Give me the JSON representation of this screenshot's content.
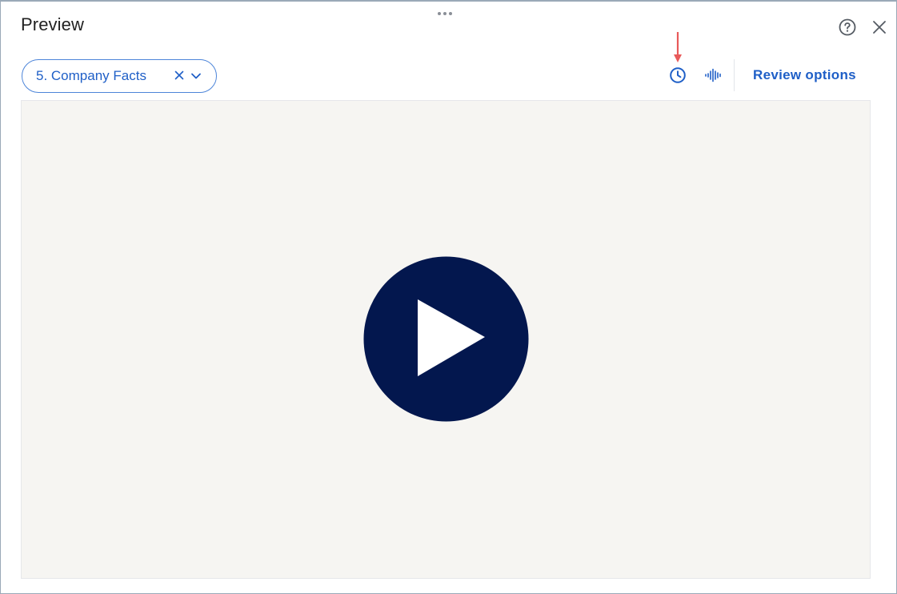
{
  "panel": {
    "title": "Preview"
  },
  "header_icons": {
    "help": "question-circle-icon",
    "close": "close-icon",
    "drag": "drag-handle-icon"
  },
  "toolbar": {
    "selector_label": "5. Company Facts",
    "clear_icon": "x-icon",
    "dropdown_icon": "chevron-down-icon",
    "clock_icon": "clock-icon",
    "audio_icon": "audio-waveform-icon",
    "review_label": "Review options"
  },
  "video": {
    "play_icon": "play-icon"
  },
  "colors": {
    "accent": "#1f5fc7",
    "play_circle": "#03174e",
    "video_bg": "#f6f5f2",
    "annotation_arrow": "#e85a5a"
  }
}
